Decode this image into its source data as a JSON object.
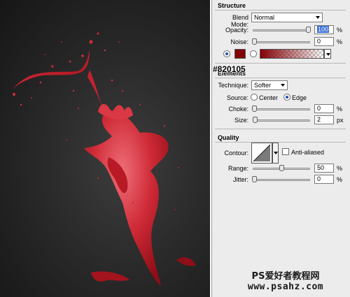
{
  "panel": {
    "structure": {
      "title": "Structure",
      "blend_mode_label": "Blend Mode:",
      "blend_mode_value": "Normal",
      "opacity_label": "Opacity:",
      "opacity_value": "100",
      "opacity_level": 1.0,
      "opacity_unit": "%",
      "noise_label": "Noise:",
      "noise_value": "0",
      "noise_level": 0,
      "noise_unit": "%",
      "color_swatch": "#820105"
    },
    "color_readout": "#820105",
    "elements": {
      "title": "Elements",
      "technique_label": "Technique:",
      "technique_value": "Softer",
      "source_label": "Source:",
      "source_center_label": "Center",
      "source_edge_label": "Edge",
      "source_selected": "Edge",
      "choke_label": "Choke:",
      "choke_value": "0",
      "choke_level": 0,
      "choke_unit": "%",
      "size_label": "Size:",
      "size_value": "2",
      "size_level": 0,
      "size_unit": "px"
    },
    "quality": {
      "title": "Quality",
      "contour_label": "Contour:",
      "anti_aliased_label": "Anti-aliased",
      "anti_aliased_checked": false,
      "range_label": "Range:",
      "range_value": "50",
      "range_level": 0.5,
      "range_unit": "%",
      "jitter_label": "Jitter:",
      "jitter_value": "0",
      "jitter_level": 0,
      "jitter_unit": "%"
    }
  },
  "watermark": {
    "line1": "PS爱好者教程网",
    "line2": "www.psahz.com"
  },
  "colors": {
    "splash": "#c4202c",
    "splash_highlight": "#e85a64",
    "panel_bg": "#ececec",
    "accent": "#3a6fd8"
  }
}
